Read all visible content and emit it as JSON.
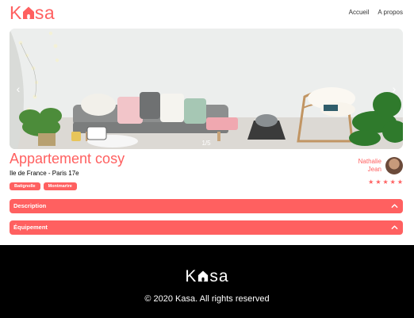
{
  "header": {
    "logo_text_start": "K",
    "logo_text_end": "sa",
    "nav": {
      "home": "Accueil",
      "about": "A propos"
    }
  },
  "banner": {
    "counter": "1/5",
    "prev_icon": "chevron-left-icon",
    "next_icon": "chevron-right-icon"
  },
  "listing": {
    "title": "Appartement cosy",
    "location": "Ile de France - Paris 17e",
    "tags": [
      "Batignolle",
      "Montmartre"
    ],
    "host": {
      "first_name": "Nathalie",
      "last_name": "Jean"
    },
    "rating": 5,
    "rating_max": 5
  },
  "collapses": {
    "description": "Description",
    "equipment": "Équipement"
  },
  "footer": {
    "logo_text_start": "K",
    "logo_text_end": "sa",
    "copyright": "© 2020 Kasa. All rights reserved"
  },
  "colors": {
    "accent": "#ff6060",
    "footer_bg": "#000000"
  }
}
